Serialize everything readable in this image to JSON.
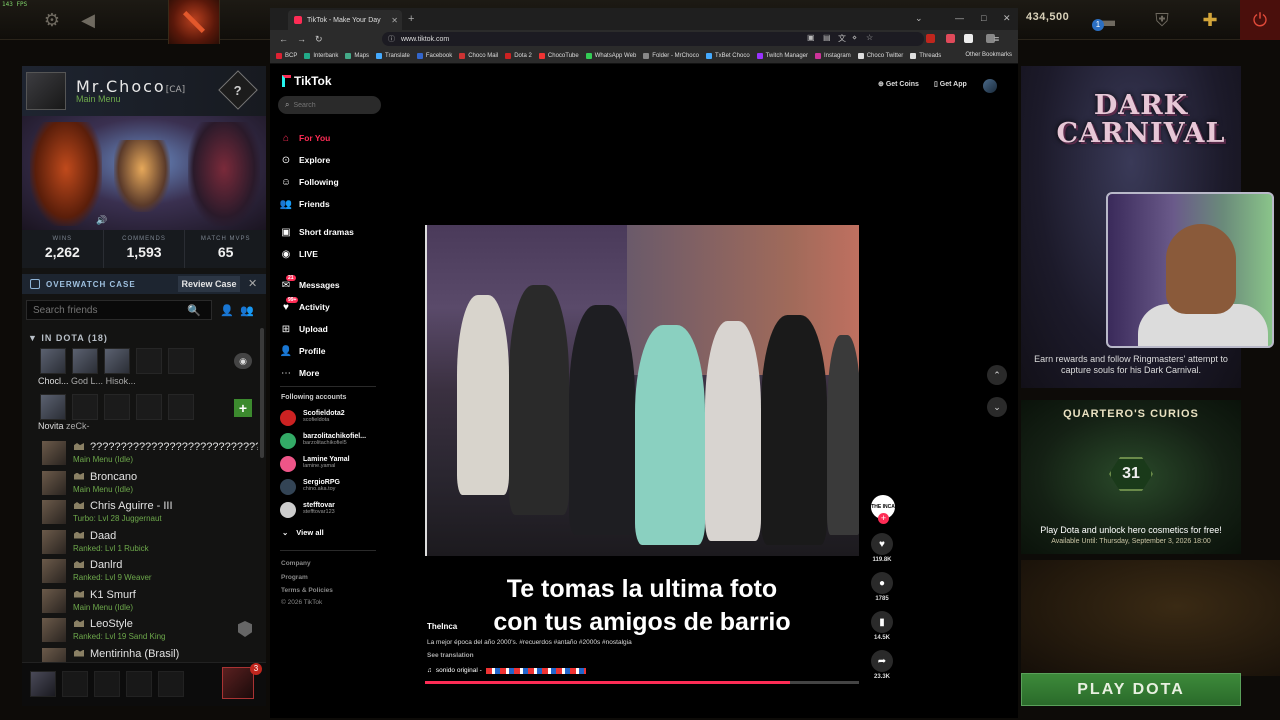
{
  "fps": "143 FPS",
  "topbar": {
    "gold": "434,500",
    "notification_count": "1"
  },
  "profile": {
    "name": "Mr.Choco",
    "tag": "[CA]",
    "status": "Main Menu",
    "stats": [
      {
        "label": "WINS",
        "value": "2,262"
      },
      {
        "label": "COMMENDS",
        "value": "1,593"
      },
      {
        "label": "MATCH MVPS",
        "value": "65"
      }
    ]
  },
  "overwatch": {
    "title": "OVERWATCH CASE",
    "review_label": "Review Case"
  },
  "friends_search": {
    "placeholder": "Search friends"
  },
  "in_dota": {
    "header": "IN DOTA (18)",
    "party_names": [
      "Chocl...",
      "God L...",
      "Hisok..."
    ],
    "second_row": [
      "Novita",
      "zeCk-"
    ]
  },
  "friends": [
    {
      "name": "????????????????????????????",
      "status": "Main Menu (Idle)"
    },
    {
      "name": "Broncano",
      "status": "Main Menu (Idle)"
    },
    {
      "name": "Chris Aguirre - III",
      "status": "Turbo: Lvl 28 Juggernaut"
    },
    {
      "name": "Daad",
      "status": "Ranked: Lvl 1 Rubick"
    },
    {
      "name": "Danlrd",
      "status": "Ranked: Lvl 9 Weaver"
    },
    {
      "name": "K1 Smurf",
      "status": "Main Menu (Idle)"
    },
    {
      "name": "LeoStyle",
      "status": "Ranked: Lvl 19 Sand King"
    },
    {
      "name": "Mentirinha (Brasil)",
      "status": ""
    }
  ],
  "me_badge": "3",
  "browser": {
    "tab_title": "TikTok - Make Your Day",
    "url": "www.tiktok.com",
    "bookmarks": [
      "BCP",
      "Interbank",
      "Maps",
      "Translate",
      "Facebook",
      "Choco Mail",
      "Dota 2",
      "ChocoTube",
      "WhatsApp Web",
      "Folder - MrChoco",
      "TxBet Choco",
      "Twitch Manager",
      "Instagram",
      "Choco Twitter",
      "Threads"
    ],
    "other_bookmarks": "Other Bookmarks"
  },
  "tiktok": {
    "logo": "TikTok",
    "search_placeholder": "Search",
    "nav": [
      "For You",
      "Explore",
      "Following",
      "Friends",
      "Short dramas",
      "LIVE",
      "Messages",
      "Activity",
      "Upload",
      "Profile",
      "More"
    ],
    "messages_badge": "21",
    "activity_badge": "99+",
    "following_header": "Following accounts",
    "following": [
      {
        "name": "Scofieldota2",
        "handle": "scofieldota"
      },
      {
        "name": "barzolitachikofiel...",
        "handle": "barzolitachikofiel5"
      },
      {
        "name": "Lamine Yamal",
        "handle": "lamine.yamal"
      },
      {
        "name": "SergioRPG",
        "handle": "chino.aka.toy"
      },
      {
        "name": "stefftovar",
        "handle": "stefftovar123"
      }
    ],
    "view_all": "View all",
    "footer": [
      "Company",
      "Program",
      "Terms & Policies",
      "© 2026 TikTok"
    ],
    "get_coins": "Get Coins",
    "get_app": "Get App",
    "caption_line1": "Te tomas la ultima foto",
    "caption_line2": "con tus amigos de barrio",
    "author": "TheInca",
    "description": "La mejor época del año 2000's. #recuerdos #antaño #2000s #nostalgia",
    "see_translation": "See translation",
    "sound": "sonido original -",
    "progress": 0.84,
    "creator_label": "THE INCA",
    "likes": "119.8K",
    "comments": "1785",
    "saves": "14.5K",
    "shares": "23.3K"
  },
  "right": {
    "dc_title": "DARK CARNIVAL",
    "dc_desc": "Earn rewards and follow Ringmasters' attempt to capture souls for his Dark Carnival.",
    "curios_title": "QUARTERO'S CURIOS",
    "curios_days": "31",
    "curios_desc": "Play Dota and unlock hero cosmetics for free!",
    "curios_avail": "Available Until:  Thursday, September 3, 2026 18:00",
    "play_label": "PLAY DOTA"
  },
  "colors": {
    "tiktok_red": "#fe2c55",
    "tiktok_cyan": "#25f4ee",
    "dota_green": "#3d8a3a",
    "status_green": "#6da84b"
  }
}
